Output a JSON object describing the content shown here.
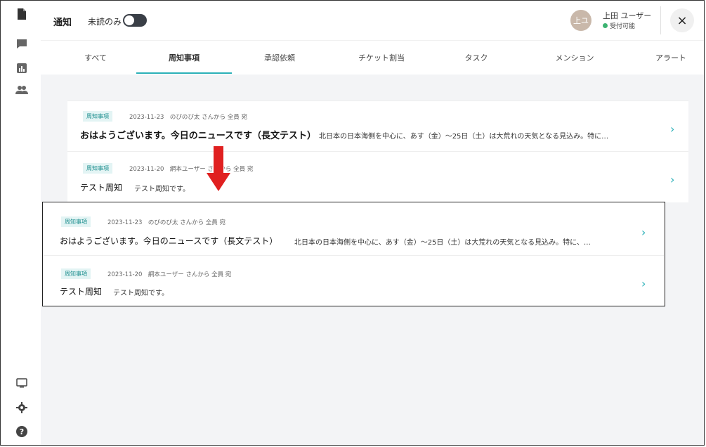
{
  "header": {
    "title": "通知",
    "unread_only_label": "未読のみ",
    "user": {
      "avatar_text": "上ユ",
      "name": "上田 ユーザー",
      "status": "受付可能"
    },
    "close_label": "×"
  },
  "sidebar": {
    "icons": [
      "document-icon",
      "chat-icon",
      "chart-icon",
      "users-icon",
      "monitor-icon",
      "settings-icon",
      "help-icon"
    ]
  },
  "tabs": [
    {
      "label": "すべて"
    },
    {
      "label": "周知事項"
    },
    {
      "label": "承認依頼"
    },
    {
      "label": "チケット割当"
    },
    {
      "label": "タスク"
    },
    {
      "label": "メンション"
    },
    {
      "label": "アラート"
    }
  ],
  "active_tab": "周知事項",
  "notifications": [
    {
      "tag": "周知事項",
      "meta": "2023-11-23　のびのび太 さんから 全員 宛",
      "title": "おはようございます。今日のニュースです（長文テスト）",
      "body": "北日本の日本海側を中心に、あす（金）～25日（土）は大荒れの天気となる見込み。特に…"
    },
    {
      "tag": "周知事項",
      "meta": "2023-11-20　網本ユーザー さんから 全員 宛",
      "title": "テスト周知",
      "body": "テスト周知です。"
    }
  ],
  "zoom_notifications": [
    {
      "tag": "周知事項",
      "meta": "2023-11-23　のびのび太 さんから 全員 宛",
      "title": "おはようございます。今日のニュースです（長文テスト）",
      "body": "北日本の日本海側を中心に、あす（金）～25日（土）は大荒れの天気となる見込み。特に、…"
    },
    {
      "tag": "周知事項",
      "meta": "2023-11-20　網本ユーザー さんから 全員 宛",
      "title": "テスト周知",
      "body": "テスト周知です。"
    }
  ],
  "colors": {
    "accent": "#2bb0b8",
    "arrow": "#e02020"
  }
}
